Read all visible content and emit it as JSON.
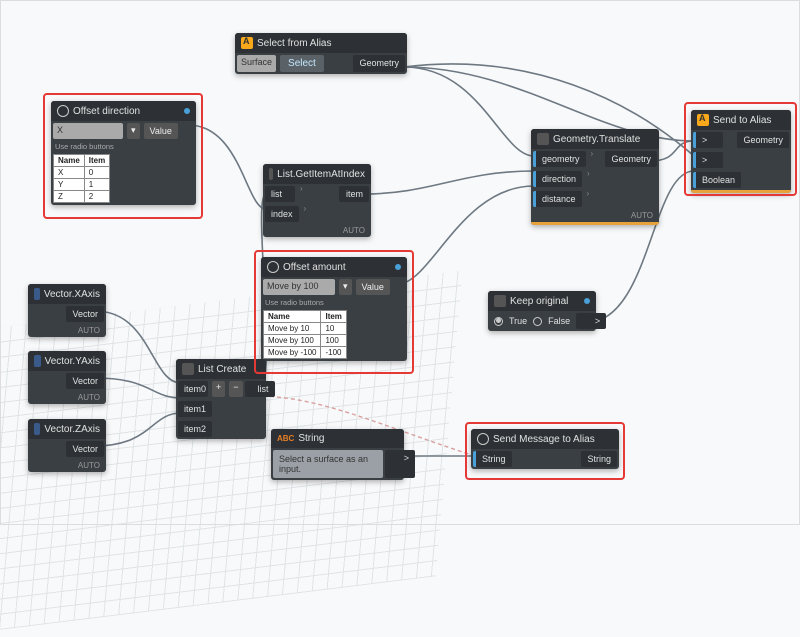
{
  "nodes": {
    "select_from_alias": {
      "title": "Select from Alias",
      "surface_label": "Surface",
      "select_button": "Select",
      "out_port": "Geometry"
    },
    "offset_direction": {
      "title": "Offset direction",
      "dropdown_value": "X",
      "value_button": "Value",
      "radio_hint": "Use radio buttons",
      "table_header_name": "Name",
      "table_header_item": "Item",
      "rows": [
        {
          "name": "X",
          "item": "0"
        },
        {
          "name": "Y",
          "item": "1"
        },
        {
          "name": "Z",
          "item": "2"
        }
      ]
    },
    "list_get_item": {
      "title": "List.GetItemAtIndex",
      "in_list": "list",
      "in_index": "index",
      "out_item": "item",
      "footer": "AUTO"
    },
    "offset_amount": {
      "title": "Offset amount",
      "dropdown_value": "Move by 100",
      "value_button": "Value",
      "radio_hint": "Use radio buttons",
      "table_header_name": "Name",
      "table_header_item": "Item",
      "rows": [
        {
          "name": "Move by 10",
          "item": "10"
        },
        {
          "name": "Move by 100",
          "item": "100"
        },
        {
          "name": "Move by -100",
          "item": "-100"
        }
      ]
    },
    "geometry_translate": {
      "title": "Geometry.Translate",
      "in_geometry": "geometry",
      "in_direction": "direction",
      "in_distance": "distance",
      "out_geometry": "Geometry",
      "footer": "AUTO"
    },
    "send_to_alias": {
      "title": "Send to Alias",
      "in1": ">",
      "in2": ">",
      "in_bool": "Boolean",
      "out_geometry": "Geometry"
    },
    "keep_original": {
      "title": "Keep original",
      "opt_true": "True",
      "opt_false": "False",
      "out": ">"
    },
    "vector_x": {
      "title": "Vector.XAxis",
      "out": "Vector",
      "footer": "AUTO"
    },
    "vector_y": {
      "title": "Vector.YAxis",
      "out": "Vector",
      "footer": "AUTO"
    },
    "vector_z": {
      "title": "Vector.ZAxis",
      "out": "Vector",
      "footer": "AUTO"
    },
    "list_create": {
      "title": "List Create",
      "in0": "item0",
      "in1": "item1",
      "in2": "item2",
      "plus": "+",
      "minus": "−",
      "out": "list"
    },
    "string": {
      "title": "String",
      "value": "Select a surface as an input.",
      "out": ">"
    },
    "send_message": {
      "title": "Send Message to Alias",
      "in_string": "String",
      "out_string": "String"
    }
  }
}
